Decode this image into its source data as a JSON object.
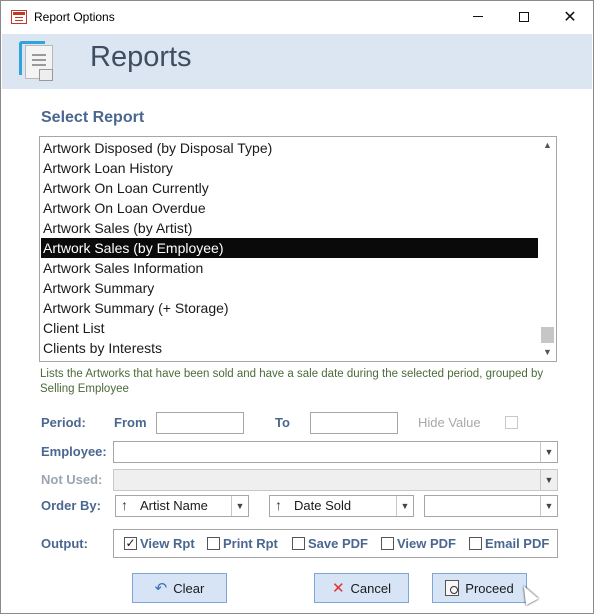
{
  "window": {
    "title": "Report Options"
  },
  "header": {
    "title": "Reports"
  },
  "select_report": {
    "label": "Select Report",
    "items": [
      "Artwork Disposed (by Disposal Type)",
      "Artwork Loan History",
      "Artwork On Loan Currently",
      "Artwork On Loan Overdue",
      "Artwork Sales (by Artist)",
      "Artwork Sales (by Employee)",
      "Artwork Sales Information",
      "Artwork Summary",
      "Artwork Summary (+ Storage)",
      "Client List",
      "Clients by Interests"
    ],
    "selected_index": 5,
    "description": "Lists the Artworks that have been sold and have a sale date during the selected period, grouped by Selling Employee"
  },
  "period": {
    "label": "Period:",
    "from_label": "From",
    "to_label": "To",
    "from_value": "",
    "to_value": "",
    "hide_value_label": "Hide Value",
    "hide_value_checked": false
  },
  "employee": {
    "label": "Employee:",
    "value": ""
  },
  "not_used": {
    "label": "Not Used:",
    "value": ""
  },
  "order_by": {
    "label": "Order By:",
    "first": "Artist Name",
    "second": "Date Sold",
    "third": ""
  },
  "output": {
    "label": "Output:",
    "options": [
      {
        "label": "View Rpt",
        "checked": true
      },
      {
        "label": "Print Rpt",
        "checked": false
      },
      {
        "label": "Save PDF",
        "checked": false
      },
      {
        "label": "View PDF",
        "checked": false
      },
      {
        "label": "Email PDF",
        "checked": false
      }
    ]
  },
  "buttons": {
    "clear": "Clear",
    "cancel": "Cancel",
    "proceed": "Proceed"
  },
  "icons": {
    "app": "report-options-app-icon",
    "header": "report-document-icon",
    "clear": "undo-arrow-icon",
    "cancel": "x-cancel-icon",
    "proceed": "preview-magnifier-icon",
    "sort": "sort-up-arrow-icon"
  },
  "colors": {
    "accent_label": "#4a6790",
    "header_band": "#dce6f2",
    "button_fill": "#d6e4f5",
    "selection": "#0a0a0a"
  }
}
